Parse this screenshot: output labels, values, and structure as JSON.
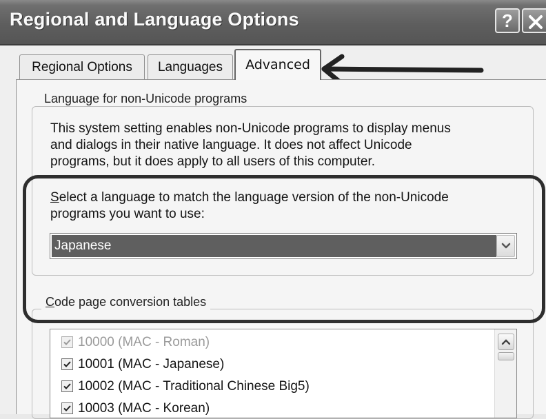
{
  "window": {
    "title": "Regional and Language Options",
    "help_label": "?"
  },
  "tabs": [
    {
      "label": "Regional Options",
      "selected": false
    },
    {
      "label": "Languages",
      "selected": false
    },
    {
      "label": "Advanced",
      "selected": true
    }
  ],
  "non_unicode": {
    "group_label": "Language for non-Unicode programs",
    "description_lines": [
      "This system setting enables non-Unicode programs to display menus",
      "and dialogs in their native language. It does not affect Unicode",
      "programs, but it does apply to all users of this computer."
    ],
    "prompt_access_key": "S",
    "prompt_line1_rest": "elect a language to match the language version of the non-Unicode",
    "prompt_line2": "programs you want to use:",
    "selected_language": "Japanese"
  },
  "code_pages": {
    "label_access_key": "C",
    "label_rest": "ode page conversion tables",
    "items": [
      {
        "label": "10000 (MAC - Roman)",
        "checked": true,
        "disabled": true
      },
      {
        "label": "10001 (MAC - Japanese)",
        "checked": true,
        "disabled": false
      },
      {
        "label": "10002 (MAC - Traditional Chinese Big5)",
        "checked": true,
        "disabled": false
      },
      {
        "label": "10003 (MAC - Korean)",
        "checked": true,
        "disabled": false
      }
    ]
  },
  "icons": {
    "help": "help-icon",
    "close": "close-icon",
    "dropdown": "chevron-down-icon",
    "scroll_up": "scroll-up-icon",
    "checkbox": "checkmark-icon",
    "annotation_arrow": "arrow-left-icon"
  },
  "colors": {
    "titlebar": "#5e5e5e",
    "selection_highlight": "#5f5f5f",
    "annotation": "#2e2e2e"
  }
}
